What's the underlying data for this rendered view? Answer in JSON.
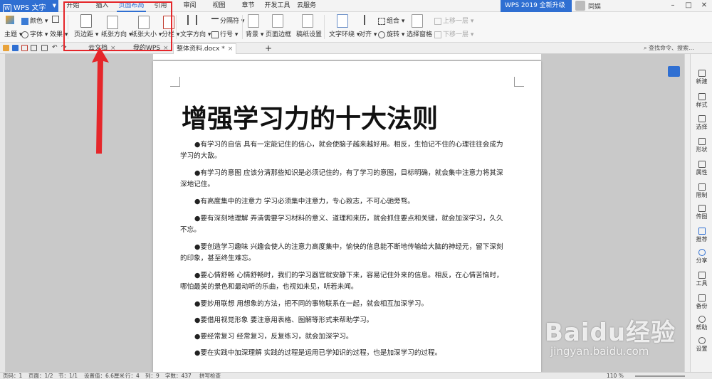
{
  "app": {
    "name": "WPS 文字"
  },
  "menu": {
    "tabs": [
      "开始",
      "插入",
      "页面布局",
      "引用",
      "审阅",
      "视图",
      "章节",
      "开发工具",
      "云服务"
    ],
    "active_index": 2
  },
  "promo": {
    "label": "WPS 2019 全新升级"
  },
  "user": {
    "name": "同娱"
  },
  "ribbon": {
    "theme": "主题",
    "color": "颜色",
    "font": "字体",
    "effect": "效果",
    "margins": "页边距",
    "orientation": "纸张方向",
    "paper_size": "纸张大小",
    "columns": "分栏",
    "text_direction": "文字方向",
    "separator": "分隔符",
    "line_number": "行号",
    "background": "背景",
    "page_border": "页面边框",
    "manuscript": "稿纸设置",
    "text_wrap": "文字环绕",
    "align": "对齐",
    "group": "组合",
    "rotate": "旋转",
    "select_pane": "选择窗格",
    "bring_forward": "上移一层",
    "send_backward": "下移一层"
  },
  "tabs": {
    "t1": "云文档",
    "t2": "我的WPS",
    "t3": "整体资料.docx *",
    "search": "查找命令、搜索..."
  },
  "document": {
    "title": "增强学习力的十大法则",
    "paragraphs": [
      "●有学习的自信 具有一定能记住的信心，就会使脑子越来越好用。相反，生怕记不住的心理往往会成为学习的大敌。",
      "●有学习的意图 应该分清那些知识是必须记住的，有了学习的意图，目标明确，就会集中注意力将其深深地记住。",
      "●有高度集中的注意力 学习必须集中注意力，专心致志，不可心驰旁骛。",
      "●要有深刻地理解 弄清需要学习材料的意义、道理和来历，就会抓住要点和关键，就会加深学习，久久不忘。",
      "●要创造学习趣味 兴趣会使人的注意力高度集中，愉快的信息能不断地传输给大脑的神经元，留下深刻的印象，甚至终生难忘。",
      "●要心情舒畅 心情舒畅时，我们的学习器官就安静下来，容易记住外来的信息。相反，在心情苦恼时，哪怕最美的景色和最动听的乐曲，也视如未见，听若未闻。",
      "●要妙用联想 用想象的方法，把不同的事物联系在一起，就会相互加深学习。",
      "●要借用视觉形象 要注意用表格、图解等形式来帮助学习。",
      "●要经常复习 经常复习，反复练习，就会加深学习。",
      "●要在实践中加深理解 实践的过程是运用已学知识的过程，也是加深学习的过程。"
    ]
  },
  "sidebar": {
    "items": [
      "新建",
      "样式",
      "选择",
      "形状",
      "属性",
      "限制",
      "传图",
      "推荐",
      "分享",
      "工具",
      "备份",
      "帮助",
      "设置"
    ]
  },
  "status": {
    "page_num": "页码：1",
    "pages": "页面：1/2",
    "section": "节：1/1",
    "position": "设置值：6.6厘米",
    "row": "行：4",
    "col": "列：9",
    "words": "字数：437",
    "spell": "拼写检查",
    "zoom": "110 %"
  },
  "watermark": {
    "main": "Baidu经验",
    "sub": "jingyan.baidu.com"
  },
  "colors": {
    "accent": "#2f6fd2",
    "highlight": "#e5262a"
  }
}
